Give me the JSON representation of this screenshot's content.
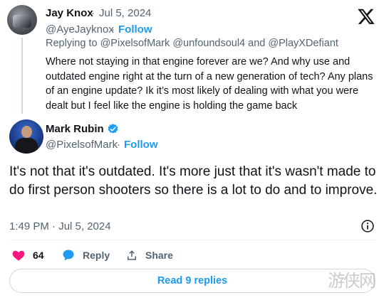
{
  "parent_tweet": {
    "author_name": "Jay Knox",
    "separator": "·",
    "date": "Jul 5, 2024",
    "handle": "@AyeJayknox",
    "follow_label": "Follow",
    "replying_prefix": "Replying to",
    "replying_mentions": "@PixelsofMark @unfoundsoul4 and @PlayXDefiant",
    "text": "Where not staying in that engine forever are we? And why use and outdated engine right at the turn of a new generation of tech? Any plans of an engine update? Ik it’s most likely of dealing with what you were dealt but I feel like the engine is holding the game back"
  },
  "main_tweet": {
    "author_name": "Mark Rubin",
    "handle": "@PixelsofMark",
    "separator": "·",
    "follow_label": "Follow",
    "text": "It's not that it's outdated. It's more just that it's wasn't made to do first person shooters so there is a lot to do and to improve.",
    "timestamp": "1:49 PM · Jul 5, 2024",
    "like_count": "64",
    "reply_label": "Reply",
    "share_label": "Share",
    "read_replies_label": "Read 9 replies"
  },
  "watermark": "游侠网",
  "colors": {
    "accent": "#1d9bf0",
    "like": "#f91880",
    "text": "#0f1419",
    "muted": "#536471",
    "border": "#cfd9de"
  },
  "icons": [
    "x-logo-icon",
    "verified-badge-icon",
    "info-icon",
    "heart-icon",
    "reply-bubble-icon",
    "share-icon"
  ]
}
